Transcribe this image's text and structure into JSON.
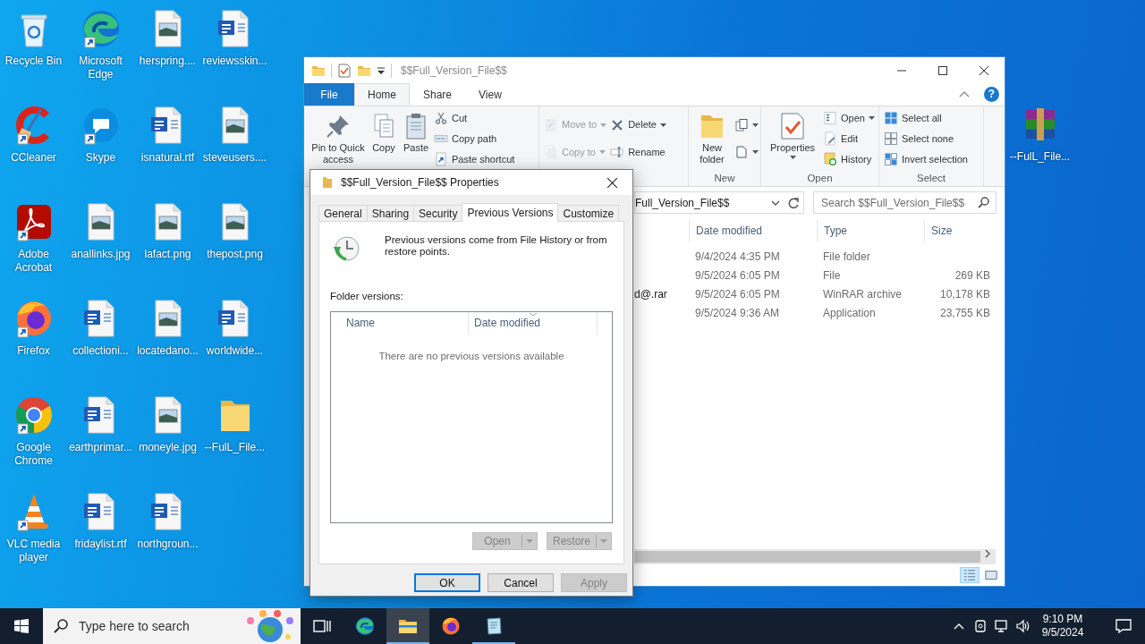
{
  "desktop_icons": [
    {
      "label": "Recycle Bin",
      "kind": "recycle",
      "shortcut": false
    },
    {
      "label": "CCleaner",
      "kind": "ccleaner",
      "shortcut": true
    },
    {
      "label": "Adobe Acrobat",
      "kind": "acrobat",
      "shortcut": true
    },
    {
      "label": "Firefox",
      "kind": "firefox",
      "shortcut": true
    },
    {
      "label": "Google Chrome",
      "kind": "chrome",
      "shortcut": true
    },
    {
      "label": "VLC media player",
      "kind": "vlc",
      "shortcut": true
    },
    {
      "label": "Microsoft Edge",
      "kind": "edge",
      "shortcut": true
    },
    {
      "label": "Skype",
      "kind": "skype",
      "shortcut": true
    },
    {
      "label": "anallinks.jpg",
      "kind": "image",
      "shortcut": false
    },
    {
      "label": "collectioni...",
      "kind": "word",
      "shortcut": false
    },
    {
      "label": "earthprimar...",
      "kind": "word",
      "shortcut": false
    },
    {
      "label": "fridaylist.rtf",
      "kind": "word",
      "shortcut": false
    },
    {
      "label": "herspring....",
      "kind": "image",
      "shortcut": false
    },
    {
      "label": "isnatural.rtf",
      "kind": "word",
      "shortcut": false
    },
    {
      "label": "lafact.png",
      "kind": "image",
      "shortcut": false
    },
    {
      "label": "locatedano...",
      "kind": "image",
      "shortcut": false
    },
    {
      "label": "moneyle.jpg",
      "kind": "image",
      "shortcut": false
    },
    {
      "label": "northgroun...",
      "kind": "word",
      "shortcut": false
    },
    {
      "label": "reviewsskin...",
      "kind": "word",
      "shortcut": false
    },
    {
      "label": "steveusers....",
      "kind": "image",
      "shortcut": false
    },
    {
      "label": "thepost.png",
      "kind": "image",
      "shortcut": false
    },
    {
      "label": "worldwide...",
      "kind": "word",
      "shortcut": false
    },
    {
      "label": "--FulL_File...",
      "kind": "folder",
      "shortcut": false
    }
  ],
  "right_icons": [
    {
      "label": "--FulL_File...",
      "kind": "winrar",
      "shortcut": false
    }
  ],
  "explorer": {
    "title": "$$Full_Version_File$$",
    "ribbon_tabs": [
      {
        "label": "File",
        "kind": "file",
        "selected": false
      },
      {
        "label": "Home",
        "kind": "tab",
        "selected": true
      },
      {
        "label": "Share",
        "kind": "tab",
        "selected": false
      },
      {
        "label": "View",
        "kind": "tab",
        "selected": false
      }
    ],
    "help_label": "?",
    "ribbon_groups": [
      {
        "columns": [
          [
            {
              "label": "Pin to Quick access",
              "kind": "pin",
              "dropdown": false,
              "disabled": false
            }
          ],
          [
            {
              "label": "Copy",
              "kind": "copy",
              "dropdown": false,
              "disabled": false
            }
          ],
          [
            {
              "label": "Paste",
              "kind": "paste",
              "dropdown": false,
              "disabled": false
            }
          ],
          [
            {
              "label": "Cut",
              "kind": "cut",
              "dropdown": false,
              "disabled": false
            },
            {
              "label": "Copy path",
              "kind": "path",
              "dropdown": false,
              "disabled": false
            },
            {
              "label": "Paste shortcut",
              "kind": "shortcut",
              "dropdown": false,
              "disabled": false
            }
          ]
        ]
      },
      {
        "columns": [
          [
            {
              "label": "Move to",
              "kind": "move",
              "dropdown": true,
              "disabled": true
            },
            {
              "label": "Copy to",
              "kind": "copyto",
              "dropdown": true,
              "disabled": true
            }
          ],
          [
            {
              "label": "Delete",
              "kind": "delete",
              "dropdown": true,
              "disabled": false
            },
            {
              "label": "Rename",
              "kind": "rename",
              "dropdown": false,
              "disabled": false
            }
          ]
        ]
      },
      {
        "label": "New",
        "columns": [
          [
            {
              "label": "New folder",
              "kind": "newfolder",
              "dropdown": false,
              "disabled": false
            }
          ],
          [
            {
              "kind": "newitem",
              "dropdown": true,
              "disabled": false
            },
            {
              "kind": "easy",
              "dropdown": true,
              "disabled": false
            }
          ]
        ]
      },
      {
        "label": "Open",
        "columns": [
          [
            {
              "label": "Properties",
              "kind": "properties",
              "dropdown": true,
              "disabled": false
            }
          ],
          [
            {
              "label": "Open",
              "kind": "open",
              "dropdown": true,
              "disabled": false
            },
            {
              "label": "Edit",
              "kind": "edit",
              "dropdown": false,
              "disabled": false
            },
            {
              "label": "History",
              "kind": "history",
              "dropdown": false,
              "disabled": false
            }
          ]
        ]
      },
      {
        "label": "Select",
        "columns": [
          [
            {
              "label": "Select all",
              "kind": "selectall",
              "dropdown": false,
              "disabled": false
            },
            {
              "label": "Select none",
              "kind": "selectnone",
              "dropdown": false,
              "disabled": false
            },
            {
              "label": "Invert selection",
              "kind": "invert",
              "dropdown": false,
              "disabled": false
            }
          ]
        ]
      }
    ],
    "address": "Full_Version_File$$",
    "search_placeholder": "Search $$Full_Version_File$$",
    "columns": [
      "Date modified",
      "Type",
      "Size"
    ],
    "rows": [
      {
        "date": "9/4/2024 4:35 PM",
        "type": "File folder"
      },
      {
        "date": "9/5/2024 6:05 PM",
        "type": "File",
        "size": "269 KB"
      },
      {
        "name": "d@.rar",
        "date": "9/5/2024 6:05 PM",
        "type": "WinRAR archive",
        "size": "10,178 KB"
      },
      {
        "date": "9/5/2024 9:36 AM",
        "type": "Application",
        "size": "23,755 KB"
      }
    ],
    "views": [
      {
        "kind": "details",
        "selected": true
      },
      {
        "kind": "tiles",
        "selected": false
      }
    ]
  },
  "dialog": {
    "title": "$$Full_Version_File$$ Properties",
    "tabs": [
      {
        "label": "General",
        "selected": false
      },
      {
        "label": "Sharing",
        "selected": false
      },
      {
        "label": "Security",
        "selected": false
      },
      {
        "label": "Previous Versions",
        "selected": true
      },
      {
        "label": "Customize",
        "selected": false
      }
    ],
    "info": "Previous versions come from File History or from restore points.",
    "list_label": "Folder versions:",
    "list_columns": [
      {
        "label": "Name",
        "sorted": false
      },
      {
        "label": "Date modified",
        "sorted": true
      }
    ],
    "empty_text": "There are no previous versions available",
    "list_buttons": [
      {
        "label": "Open",
        "disabled": true
      },
      {
        "label": "Restore",
        "disabled": true
      }
    ],
    "buttons": [
      {
        "label": "OK",
        "default": true,
        "disabled": false
      },
      {
        "label": "Cancel",
        "default": false,
        "disabled": false
      },
      {
        "label": "Apply",
        "default": false,
        "disabled": true
      }
    ]
  },
  "taskbar": {
    "search_placeholder": "Type here to search",
    "apps": [
      {
        "kind": "taskview",
        "selected": false,
        "running": false
      },
      {
        "kind": "edge",
        "selected": false,
        "running": false
      },
      {
        "kind": "explorer",
        "selected": true,
        "running": true
      },
      {
        "kind": "firefox",
        "selected": false,
        "running": false
      },
      {
        "kind": "notepad",
        "selected": false,
        "running": true
      }
    ],
    "time": "9:10 PM",
    "date": "9/5/2024"
  }
}
